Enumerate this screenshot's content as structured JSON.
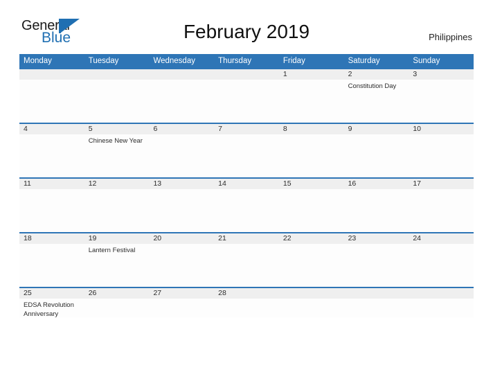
{
  "brand": {
    "name_part1": "General",
    "name_part2": "Blue",
    "logo_icon": "flag-triangle-icon",
    "accent_color": "#2e75b6"
  },
  "header": {
    "title": "February 2019",
    "country": "Philippines"
  },
  "calendar": {
    "weekday_headers": [
      "Monday",
      "Tuesday",
      "Wednesday",
      "Thursday",
      "Friday",
      "Saturday",
      "Sunday"
    ],
    "header_bg": "#2e75b6",
    "date_band_bg": "#efefef",
    "row_divider_color": "#2e75b6",
    "weeks": [
      {
        "days": [
          {
            "date": "",
            "event": ""
          },
          {
            "date": "",
            "event": ""
          },
          {
            "date": "",
            "event": ""
          },
          {
            "date": "",
            "event": ""
          },
          {
            "date": "1",
            "event": ""
          },
          {
            "date": "2",
            "event": "Constitution Day"
          },
          {
            "date": "3",
            "event": ""
          }
        ]
      },
      {
        "days": [
          {
            "date": "4",
            "event": ""
          },
          {
            "date": "5",
            "event": "Chinese New Year"
          },
          {
            "date": "6",
            "event": ""
          },
          {
            "date": "7",
            "event": ""
          },
          {
            "date": "8",
            "event": ""
          },
          {
            "date": "9",
            "event": ""
          },
          {
            "date": "10",
            "event": ""
          }
        ]
      },
      {
        "days": [
          {
            "date": "11",
            "event": ""
          },
          {
            "date": "12",
            "event": ""
          },
          {
            "date": "13",
            "event": ""
          },
          {
            "date": "14",
            "event": ""
          },
          {
            "date": "15",
            "event": ""
          },
          {
            "date": "16",
            "event": ""
          },
          {
            "date": "17",
            "event": ""
          }
        ]
      },
      {
        "days": [
          {
            "date": "18",
            "event": ""
          },
          {
            "date": "19",
            "event": "Lantern Festival"
          },
          {
            "date": "20",
            "event": ""
          },
          {
            "date": "21",
            "event": ""
          },
          {
            "date": "22",
            "event": ""
          },
          {
            "date": "23",
            "event": ""
          },
          {
            "date": "24",
            "event": ""
          }
        ]
      },
      {
        "days": [
          {
            "date": "25",
            "event": "EDSA Revolution Anniversary"
          },
          {
            "date": "26",
            "event": ""
          },
          {
            "date": "27",
            "event": ""
          },
          {
            "date": "28",
            "event": ""
          },
          {
            "date": "",
            "event": ""
          },
          {
            "date": "",
            "event": ""
          },
          {
            "date": "",
            "event": ""
          }
        ]
      }
    ]
  }
}
